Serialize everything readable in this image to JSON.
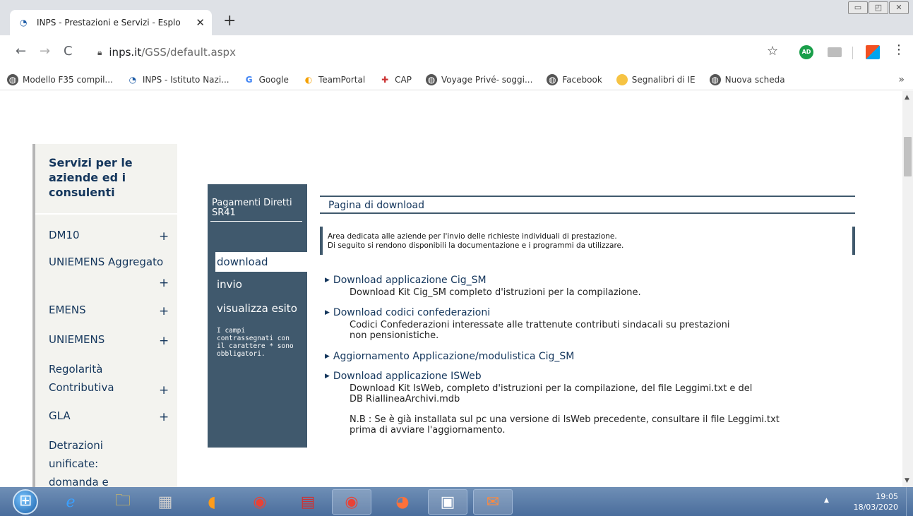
{
  "browser": {
    "tab_title": "INPS - Prestazioni e Servizi - Esplo",
    "tab_close": "✕",
    "new_tab": "+",
    "window_controls": [
      "▭",
      "◰",
      "✕"
    ],
    "nav": {
      "back": "←",
      "forward": "→",
      "reload": "C"
    },
    "url_host": "inps.it",
    "url_path": "/GSS/default.aspx",
    "star": "☆",
    "ext_ad": "AD",
    "kebab": "⋮",
    "bookmarks": [
      {
        "label": "Modello F35 compil...",
        "icon": "globe-icon"
      },
      {
        "label": "INPS - Istituto Nazi...",
        "icon": "inps-icon"
      },
      {
        "label": "Google",
        "icon": "google-icon"
      },
      {
        "label": "TeamPortal",
        "icon": "teamportal-icon"
      },
      {
        "label": "CAP",
        "icon": "cap-icon"
      },
      {
        "label": "Voyage Privé- soggi...",
        "icon": "globe-icon"
      },
      {
        "label": "Facebook",
        "icon": "globe-icon"
      },
      {
        "label": "Segnalibri di IE",
        "icon": "folder-icon"
      },
      {
        "label": "Nuova scheda",
        "icon": "globe-icon"
      }
    ],
    "bookmarks_more": "»"
  },
  "sidebar": {
    "title": "Servizi per le aziende ed i consulenti",
    "items": [
      {
        "label": "DM10",
        "plus": "+"
      },
      {
        "label": "UNIEMENS Aggregato",
        "plus": "+"
      },
      {
        "label": "EMENS",
        "plus": "+"
      },
      {
        "label": "UNIEMENS",
        "plus": "+"
      },
      {
        "label": "Regolarità Contributiva",
        "plus": "+"
      },
      {
        "label": "GLA",
        "plus": "+"
      },
      {
        "label": "Detrazioni unificate: domanda e",
        "plus": ""
      }
    ]
  },
  "leftnav": {
    "title": "Pagamenti Diretti SR41",
    "items": [
      "download",
      "invio",
      "visualizza esito"
    ],
    "note": "I campi contrassegnati con il carattere * sono obbligatori."
  },
  "content": {
    "header": "Pagina di download",
    "info_line1": "Area dedicata alle aziende per l'invio delle richieste individuali di prestazione.",
    "info_line2": "Di seguito si rendono disponibili la documentazione e i programmi da utilizzare.",
    "downloads": [
      {
        "link": "Download applicazione Cig_SM",
        "desc": "Download Kit Cig_SM completo d'istruzioni per la compilazione."
      },
      {
        "link": "Download codici confederazioni",
        "desc": "Codici Confederazioni interessate alle trattenute contributi sindacali su prestazioni non pensionistiche."
      },
      {
        "link": "Aggiornamento Applicazione/modulistica Cig_SM",
        "desc": ""
      },
      {
        "link": "Download applicazione ISWeb",
        "desc": "Download Kit IsWeb, completo d'istruzioni per la compilazione, del file Leggimi.txt e del DB RiallineaArchivi.mdb",
        "note": "N.B : Se è già installata sul pc una versione di IsWeb precedente, consultare il file Leggimi.txt prima di avviare l'aggiornamento."
      }
    ]
  },
  "taskbar": {
    "time": "19:05",
    "date": "18/03/2020"
  }
}
